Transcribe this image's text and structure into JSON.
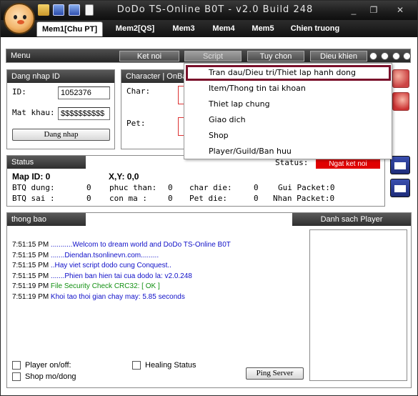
{
  "window": {
    "title": "DoDo TS-Online B0T - v2.0 Build 248",
    "controls": [
      "_",
      "❐",
      "✕"
    ]
  },
  "tabs": [
    "Mem1[Chu PT]",
    "Mem2[QS]",
    "Mem3",
    "Mem4",
    "Mem5",
    "Chien truong"
  ],
  "menu": {
    "label": "Menu",
    "buttons": [
      "Ket noi",
      "Script",
      "Tuy chon",
      "Dieu khien"
    ]
  },
  "dropdown": {
    "items": [
      "Tran dau/Dieu tri/Thiet lap hanh dong",
      "Item/Thong tin tai khoan",
      "Thiet lap chung",
      "Giao dich",
      "Shop",
      "Player/Guild/Ban huu"
    ]
  },
  "login": {
    "header": "Dang nhap ID",
    "id_label": "ID:",
    "id_value": "1052376",
    "pass_label": "Mat khau:",
    "pass_value": "$$$$$$$$$$",
    "button": "Dang nhap"
  },
  "character": {
    "header": "Character | OnBa",
    "char_label": "Char:",
    "pet_label": "Pet:"
  },
  "status": {
    "header": "Status",
    "status_label": "Status:",
    "status_value": "Ngat ket noi",
    "map_id": "Map ID: 0",
    "xy": "X,Y: 0,0",
    "row1": [
      "BTQ dung:",
      "0",
      "phuc than:",
      "0",
      "char die:",
      "0",
      "Gui Packet:0"
    ],
    "row2": [
      "BTQ sai :",
      "0",
      "con ma :",
      "0",
      "Pet die:",
      "0",
      "Nhan Packet:0"
    ]
  },
  "log": {
    "header": "thong bao",
    "player_list_header": "Danh sach Player",
    "lines": [
      {
        "time": "7:51:15 PM",
        "text": "...........Welcom to dream world and DoDo TS-Online B0T",
        "color": "blue"
      },
      {
        "time": "7:51:15 PM",
        "text": ".......Diendan.tsonlinevn.com.........",
        "color": "blue"
      },
      {
        "time": "7:51:15 PM",
        "text": "..Hay viet script dodo cung Conquest..",
        "color": "blue"
      },
      {
        "time": "7:51:15 PM",
        "text": ".......Phien ban hien tai cua dodo la: v2.0.248",
        "color": "blue"
      },
      {
        "time": "7:51:19 PM",
        "text": "File Security Check CRC32: [ OK ]",
        "color": "green"
      },
      {
        "time": "7:51:19 PM",
        "text": "Khoi tao thoi gian chay may: 5.85 seconds",
        "color": "blue"
      }
    ]
  },
  "footer": {
    "player_onoff": "Player on/off:",
    "shop_modong": "Shop mo/dong",
    "healing_status": "Healing Status",
    "ping_button": "Ping Server"
  },
  "colors": {
    "badge_red": "#e00000",
    "log_blue": "#1010c8",
    "log_green": "#129012",
    "selection_border": "#7a0f2a"
  }
}
